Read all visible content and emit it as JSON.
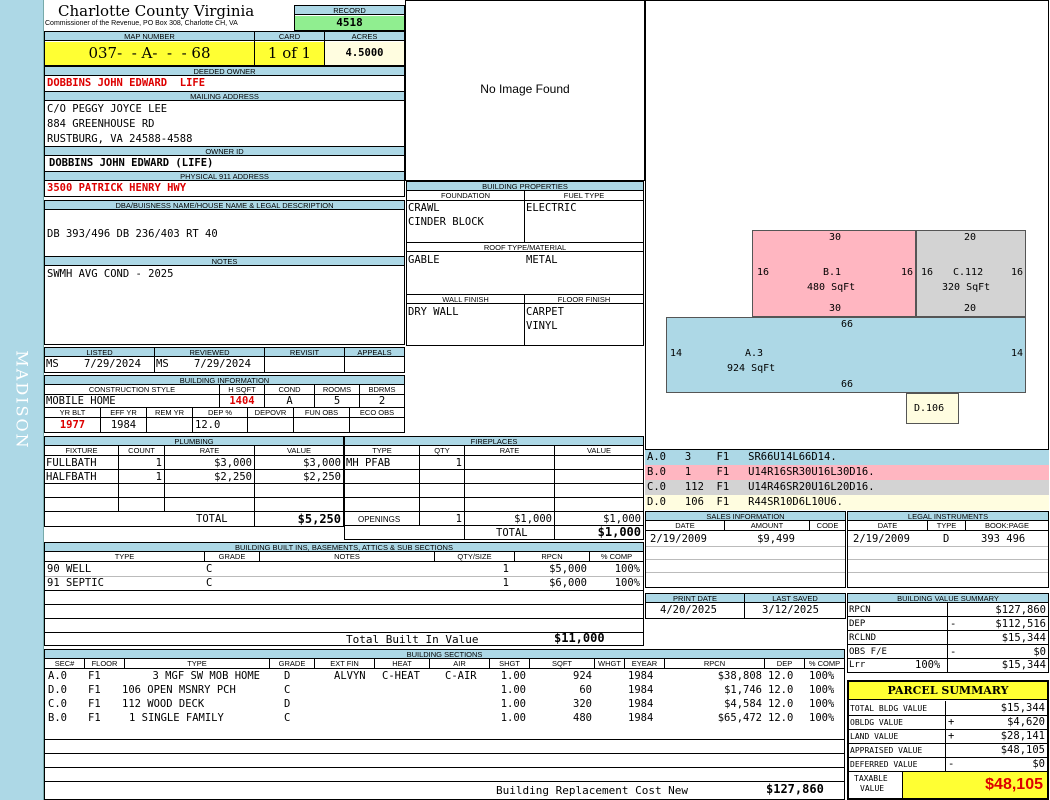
{
  "county": {
    "title": "Charlotte County Virginia",
    "subtitle": "Commissioner of the Revenue, PO Box 308, Charlotte CH, VA"
  },
  "district": "MADISON",
  "record": {
    "label": "RECORD",
    "value": "4518"
  },
  "map": {
    "label": "MAP NUMBER",
    "value": "037-  - A-  -  - 68"
  },
  "card": {
    "label": "CARD",
    "value": "1 of 1"
  },
  "acres": {
    "label": "ACRES",
    "value": "4.5000"
  },
  "owner": {
    "label": "DEEDED OWNER",
    "value": "DOBBINS JOHN EDWARD  LIFE"
  },
  "mailing": {
    "label": "MAILING ADDRESS",
    "line1": "C/O PEGGY JOYCE LEE",
    "line2": "884 GREENHOUSE RD",
    "line3": "RUSTBURG, VA 24588-4588"
  },
  "owner_id": {
    "label": "OWNER ID",
    "value": "DOBBINS JOHN EDWARD (LIFE)"
  },
  "physical": {
    "label": "PHYSICAL 911 ADDRESS",
    "value": "3500 PATRICK HENRY HWY"
  },
  "legal": {
    "label": "DBA/BUISNESS NAME/HOUSE NAME & LEGAL DESCRIPTION",
    "value": "DB 393/496 DB 236/403 RT 40"
  },
  "notes": {
    "label": "NOTES",
    "value": "SWMH AVG COND - 2025"
  },
  "image": {
    "text": "No Image Found"
  },
  "listed": {
    "label": "LISTED",
    "by": "MS",
    "date": "7/29/2024"
  },
  "reviewed": {
    "label": "REVIEWED",
    "by": "MS",
    "date": "7/29/2024"
  },
  "revisit": {
    "label": "REVISIT"
  },
  "appeals": {
    "label": "APPEALS"
  },
  "building_info": {
    "label": "BUILDING INFORMATION",
    "h": {
      "style": "CONSTRUCTION STYLE",
      "hsqft": "H SQFT",
      "cond": "COND",
      "rooms": "ROOMS",
      "bdrms": "BDRMS",
      "yrblt": "YR BLT",
      "effyr": "EFF YR",
      "remyr": "REM YR",
      "dep": "DEP %",
      "depovr": "DEPOVR",
      "funobs": "FUN OBS",
      "ecoobs": "ECO OBS"
    },
    "style": "MOBILE HOME",
    "hsqft": "1404",
    "cond": "A",
    "rooms": "5",
    "bdrms": "2",
    "yrblt": "1977",
    "effyr": "1984",
    "remyr": "",
    "dep": "12.0"
  },
  "building_props": {
    "label": "BUILDING PROPERTIES",
    "foundation_label": "FOUNDATION",
    "fuel_label": "FUEL TYPE",
    "foundation1": "CRAWL",
    "foundation2": "CINDER BLOCK",
    "fuel": "ELECTRIC",
    "roof_label": "ROOF TYPE/MATERIAL",
    "roof1": "GABLE",
    "roof2": "METAL",
    "wall_label": "WALL FINISH",
    "floor_label": "FLOOR FINISH",
    "wall": "DRY WALL",
    "floor1": "CARPET",
    "floor2": "VINYL"
  },
  "plumbing": {
    "label": "PLUMBING",
    "h": {
      "fixture": "FIXTURE",
      "count": "COUNT",
      "rate": "RATE",
      "value": "VALUE"
    },
    "rows": [
      {
        "fixture": "FULLBATH",
        "count": "1",
        "rate": "$3,000",
        "value": "$3,000"
      },
      {
        "fixture": "HALFBATH",
        "count": "1",
        "rate": "$2,250",
        "value": "$2,250"
      }
    ],
    "total_label": "TOTAL",
    "total": "$5,250"
  },
  "fireplaces": {
    "label": "FIREPLACES",
    "h": {
      "type": "TYPE",
      "qty": "QTY",
      "rate": "RATE",
      "value": "VALUE"
    },
    "rows": [
      {
        "type": "MH PFAB",
        "qty": "1"
      }
    ],
    "openings_label": "OPENINGS",
    "openings_qty": "1",
    "openings_rate": "$1,000",
    "openings_value": "$1,000",
    "total_label": "TOTAL",
    "total": "$1,000"
  },
  "builtins": {
    "label": "BUILDING BUILT INS, BASEMENTS, ATTICS & SUB SECTIONS",
    "h": {
      "type": "TYPE",
      "grade": "GRADE",
      "notes": "NOTES",
      "qty": "QTY/SIZE",
      "rpcn": "RPCN",
      "comp": "% COMP"
    },
    "rows": [
      {
        "type": "90 WELL",
        "grade": "C",
        "qty": "1",
        "rpcn": "$5,000",
        "comp": "100%"
      },
      {
        "type": "91 SEPTIC",
        "grade": "C",
        "qty": "1",
        "rpcn": "$6,000",
        "comp": "100%"
      }
    ],
    "total_label": "Total Built In Value",
    "total": "$11,000"
  },
  "sketch": {
    "b": {
      "label": "B.1",
      "area": "480 SqFt",
      "top": "30",
      "bottom": "30",
      "left": "16",
      "right": "16"
    },
    "c": {
      "label": "C.112",
      "area": "320 SqFt",
      "top": "20",
      "bottom": "20",
      "left": "16",
      "right": "16"
    },
    "a": {
      "label": "A.3",
      "area": "924 SqFt",
      "top": "66",
      "bottom": "66",
      "left": "14",
      "right": "14"
    },
    "d": {
      "label": "D.106"
    },
    "legend": [
      {
        "text": "A.0   3    F1   SR66U14L66D14.",
        "color": "#add8e6"
      },
      {
        "text": "B.0   1    F1   U14R16SR30U16L30D16.",
        "color": "#ffb6c1"
      },
      {
        "text": "C.0   112  F1   U14R46SR20U16L20D16.",
        "color": "#d3d3d3"
      },
      {
        "text": "D.0   106  F1   R44SR10D6L10U6.",
        "color": "#fffde0"
      }
    ]
  },
  "sales": {
    "label": "SALES INFORMATION",
    "h": {
      "date": "DATE",
      "amount": "AMOUNT",
      "code": "CODE"
    },
    "rows": [
      {
        "date": "2/19/2009",
        "amount": "$9,499",
        "code": ""
      }
    ]
  },
  "legal_instr": {
    "label": "LEGAL INSTRUMENTS",
    "h": {
      "date": "DATE",
      "type": "TYPE",
      "book": "BOOK:PAGE"
    },
    "rows": [
      {
        "date": "2/19/2009",
        "type": "D",
        "book": "393 496"
      }
    ]
  },
  "print": {
    "label": "PRINT DATE",
    "value": "4/20/2025"
  },
  "saved": {
    "label": "LAST SAVED",
    "value": "3/12/2025"
  },
  "bvs": {
    "label": "BUILDING VALUE SUMMARY",
    "rows": [
      {
        "label": "RPCN",
        "sign": "",
        "value": "$127,860"
      },
      {
        "label": "DEP",
        "sign": "-",
        "value": "$112,516"
      },
      {
        "label": "RCLND",
        "sign": "",
        "value": "$15,344"
      },
      {
        "label": "OBS F/E",
        "sign": "-",
        "value": "$0"
      },
      {
        "label": "Lrr",
        "pct": "100%",
        "sign": "",
        "value": "$15,344"
      }
    ]
  },
  "parcel": {
    "label": "PARCEL SUMMARY",
    "rows": [
      {
        "label": "TOTAL BLDG VALUE",
        "sign": "",
        "value": "$15,344"
      },
      {
        "label": "OBLDG VALUE",
        "sign": "+",
        "value": "$4,620"
      },
      {
        "label": "LAND VALUE",
        "sign": "+",
        "value": "$28,141"
      },
      {
        "label": "APPRAISED VALUE",
        "sign": "",
        "value": "$48,105"
      },
      {
        "label": "DEFERRED VALUE",
        "sign": "-",
        "value": "$0"
      }
    ],
    "taxable_label1": "TAXABLE",
    "taxable_label2": "VALUE",
    "taxable": "$48,105"
  },
  "sections": {
    "label": "BUILDING SECTIONS",
    "h": {
      "sec": "SEC#",
      "floor": "FLOOR",
      "type": "TYPE",
      "grade": "GRADE",
      "extfin": "EXT FIN",
      "heat": "HEAT",
      "air": "AIR",
      "shgt": "SHGT",
      "sqft": "SQFT",
      "whgt": "WHGT",
      "eyear": "EYEAR",
      "rpcn": "RPCN",
      "dep": "DEP",
      "comp": "% COMP"
    },
    "rows": [
      {
        "sec": "A.0",
        "floor": "F1",
        "type": "3 MGF SW MOB HOME",
        "grade": "D",
        "extfin": "ALVYN",
        "heat": "C-HEAT",
        "air": "C-AIR",
        "shgt": "1.00",
        "sqft": "924",
        "eyear": "1984",
        "rpcn": "$38,808",
        "dep": "12.0",
        "comp": "100%"
      },
      {
        "sec": "D.0",
        "floor": "F1",
        "type": "106 OPEN MSNRY PCH",
        "grade": "C",
        "extfin": "",
        "heat": "",
        "air": "",
        "shgt": "1.00",
        "sqft": "60",
        "eyear": "1984",
        "rpcn": "$1,746",
        "dep": "12.0",
        "comp": "100%"
      },
      {
        "sec": "C.0",
        "floor": "F1",
        "type": "112 WOOD DECK",
        "grade": "D",
        "extfin": "",
        "heat": "",
        "air": "",
        "shgt": "1.00",
        "sqft": "320",
        "eyear": "1984",
        "rpcn": "$4,584",
        "dep": "12.0",
        "comp": "100%"
      },
      {
        "sec": "B.0",
        "floor": "F1",
        "type": "1 SINGLE FAMILY",
        "grade": "C",
        "extfin": "",
        "heat": "",
        "air": "",
        "shgt": "1.00",
        "sqft": "480",
        "eyear": "1984",
        "rpcn": "$65,472",
        "dep": "12.0",
        "comp": "100%"
      }
    ],
    "total_label": "Building Replacement Cost New",
    "total": "$127,860"
  }
}
